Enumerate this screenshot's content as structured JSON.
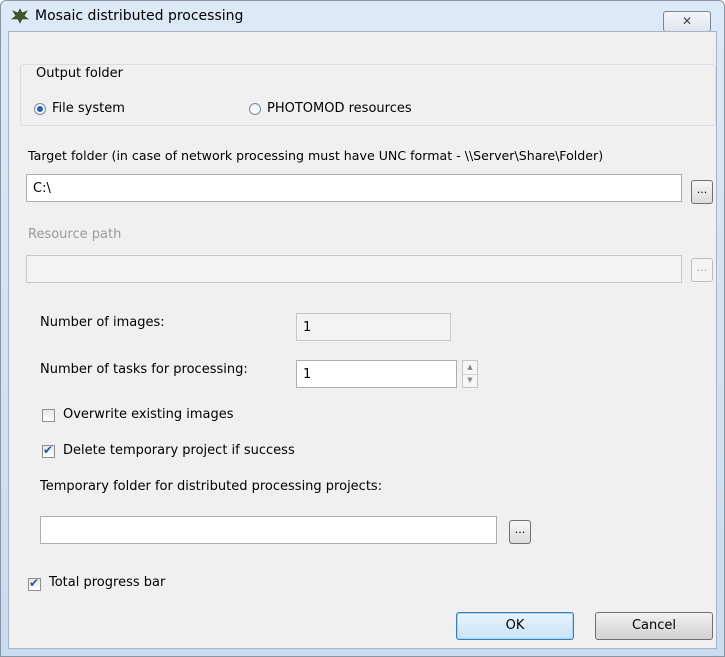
{
  "window": {
    "title": "Mosaic distributed processing",
    "close_label": "✕"
  },
  "output_folder": {
    "title": "Output folder",
    "options": [
      {
        "label": "File system",
        "selected": true
      },
      {
        "label": "PHOTOMOD resources",
        "selected": false
      }
    ]
  },
  "target_folder": {
    "label": "Target folder (in case of network processing must have UNC format - \\\\Server\\Share\\Folder)",
    "value": "C:\\",
    "browse_label": "..."
  },
  "resource_path": {
    "label": "Resource path",
    "value": "",
    "browse_label": "...",
    "enabled": false
  },
  "num_images": {
    "label": "Number of images:",
    "value": "1"
  },
  "num_tasks": {
    "label": "Number of tasks for processing:",
    "value": "1",
    "up": "▲",
    "down": "▼"
  },
  "overwrite": {
    "label": "Overwrite existing images",
    "checked": false
  },
  "delete_temp": {
    "label": "Delete temporary project if success",
    "checked": true
  },
  "temp_folder": {
    "label": "Temporary folder for distributed processing projects:",
    "value": "",
    "browse_label": "..."
  },
  "total_progress": {
    "label": "Total progress bar",
    "checked": true
  },
  "buttons": {
    "ok": "OK",
    "cancel": "Cancel"
  }
}
